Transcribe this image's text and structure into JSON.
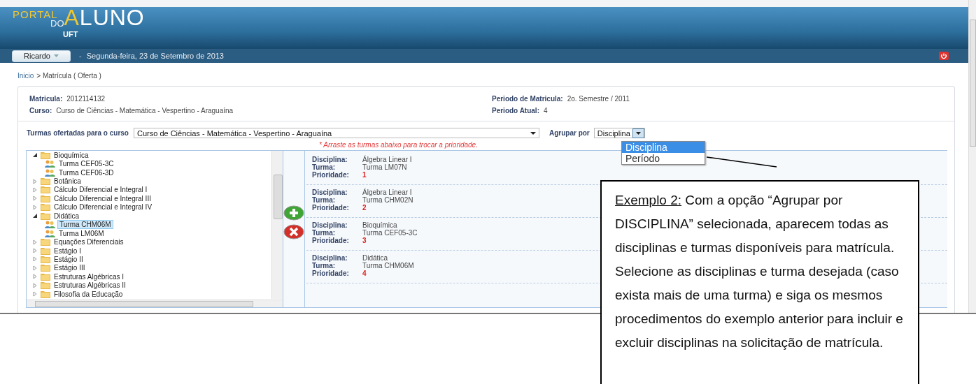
{
  "header": {
    "logo": {
      "portal": "PORTAL",
      "do": "DO",
      "aluno": "ALUNO",
      "org": "UFT"
    }
  },
  "nav": {
    "user": "Ricardo",
    "separator": "-",
    "date": "Segunda-feira, 23 de Setembro de 2013"
  },
  "breadcrumb": {
    "home": "Inicio",
    "current": "> Matrícula ( Oferta )"
  },
  "info": {
    "left": [
      {
        "label": "Matricula:",
        "value": "2012114132"
      },
      {
        "label": "Curso:",
        "value": "Curso de Ciências - Matemática - Vespertino - Araguaína"
      }
    ],
    "right": [
      {
        "label": "Periodo de Matricula:",
        "value": "2o. Semestre / 2011"
      },
      {
        "label": "Periodo Atual:",
        "value": "4"
      }
    ]
  },
  "filter": {
    "course_label": "Turmas ofertadas para o curso",
    "course_value": "Curso de Ciências - Matemática - Vespertino - Araguaína",
    "group_label": "Agrupar por",
    "group_value": "Disciplina",
    "group_options": [
      {
        "label": "Disciplina",
        "selected": true
      },
      {
        "label": "Período",
        "selected": false
      }
    ]
  },
  "hint": "* Arraste as turmas abaixo para trocar a prioridade.",
  "tree": [
    {
      "kind": "folder",
      "label": "Bioquímica",
      "expanded": true,
      "children": [
        {
          "kind": "class",
          "label": "Turma CEF05-3C",
          "selected": false
        },
        {
          "kind": "class",
          "label": "Turma CEF06-3D",
          "selected": false
        }
      ]
    },
    {
      "kind": "folder",
      "label": "Botânica",
      "expanded": false
    },
    {
      "kind": "folder",
      "label": "Cálculo Diferencial e Integral I",
      "expanded": false
    },
    {
      "kind": "folder",
      "label": "Cálculo Diferencial e Integral III",
      "expanded": false
    },
    {
      "kind": "folder",
      "label": "Cálculo Diferencial e Integral IV",
      "expanded": false
    },
    {
      "kind": "folder",
      "label": "Didática",
      "expanded": true,
      "children": [
        {
          "kind": "class",
          "label": "Turma CHM06M",
          "selected": true
        },
        {
          "kind": "class",
          "label": "Turma LM06M",
          "selected": false
        }
      ]
    },
    {
      "kind": "folder",
      "label": "Equações Diferenciais",
      "expanded": false
    },
    {
      "kind": "folder",
      "label": "Estágio I",
      "expanded": false
    },
    {
      "kind": "folder",
      "label": "Estágio II",
      "expanded": false
    },
    {
      "kind": "folder",
      "label": "Estágio III",
      "expanded": false
    },
    {
      "kind": "folder",
      "label": "Estruturas Algébricas I",
      "expanded": false
    },
    {
      "kind": "folder",
      "label": "Estruturas Algébricas II",
      "expanded": false
    },
    {
      "kind": "folder",
      "label": "Filosofia da Educação",
      "expanded": false
    }
  ],
  "enrollments": [
    {
      "discipline_label": "Disciplina:",
      "discipline": "Álgebra Linear I",
      "class_label": "Turma:",
      "class": "Turma LM07N",
      "priority_label": "Prioridade:",
      "priority": "1"
    },
    {
      "discipline_label": "Disciplina:",
      "discipline": "Álgebra Linear I",
      "class_label": "Turma:",
      "class": "Turma CHM02N",
      "priority_label": "Prioridade:",
      "priority": "2"
    },
    {
      "discipline_label": "Disciplina:",
      "discipline": "Bioquímica",
      "class_label": "Turma:",
      "class": "Turma CEF05-3C",
      "priority_label": "Prioridade:",
      "priority": "3"
    },
    {
      "discipline_label": "Disciplina:",
      "discipline": "Didática",
      "class_label": "Turma:",
      "class": "Turma CHM06M",
      "priority_label": "Prioridade:",
      "priority": "4"
    }
  ],
  "callout": {
    "title": "Exemplo 2:",
    "text": "Com a opção “Agrupar por DISCIPLINA” selecionada, aparecem todas as disciplinas e turmas disponíveis para matrícula. Selecione as disciplinas e turma desejada (caso exista mais de uma turma) e siga os mesmos procedimentos do exemplo anterior para incluir e excluir disciplinas na solicitação de matrícula."
  }
}
